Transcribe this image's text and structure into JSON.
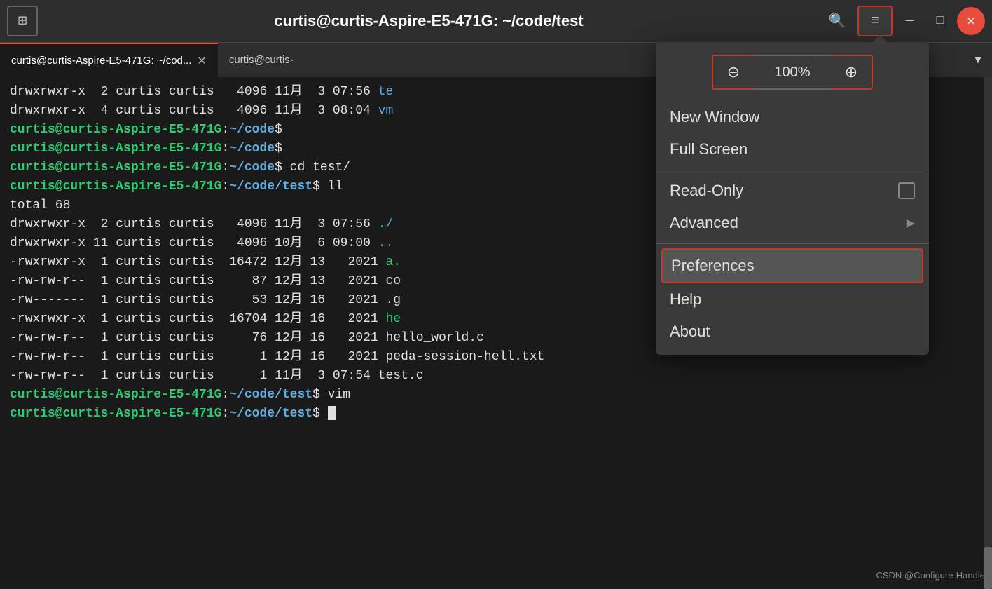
{
  "titlebar": {
    "new_tab_icon": "⊞",
    "title": "curtis@curtis-Aspire-E5-471G: ~/code/test",
    "search_icon": "⌕",
    "menu_icon": "≡",
    "minimize_icon": "—",
    "maximize_icon": "□",
    "close_icon": "✕"
  },
  "tabs": {
    "tab1_label": "curtis@curtis-Aspire-E5-471G: ~/cod...",
    "tab2_label": "curtis@curtis-",
    "dropdown_icon": "▼"
  },
  "terminal": {
    "lines": [
      {
        "type": "file",
        "text": "drwxrwxr-x  2 curtis curtis   4096 11月  3 07:56 ",
        "filename": "te",
        "file_color": "blue"
      },
      {
        "type": "file",
        "text": "drwxrwxr-x  4 curtis curtis   4096 11月  3 08:04 ",
        "filename": "vm",
        "file_color": "blue"
      },
      {
        "type": "prompt",
        "user": "curtis@curtis-Aspire-E5-471G",
        "path": "~/code",
        "cmd": "$"
      },
      {
        "type": "prompt",
        "user": "curtis@curtis-Aspire-E5-471G",
        "path": "~/code",
        "cmd": "$"
      },
      {
        "type": "prompt",
        "user": "curtis@curtis-Aspire-E5-471G",
        "path": "~/code",
        "cmd": "$ cd test/"
      },
      {
        "type": "prompt",
        "user": "curtis@curtis-Aspire-E5-471G",
        "path": "~/code/test",
        "cmd": "$ ll"
      },
      {
        "type": "plain",
        "text": "total 68"
      },
      {
        "type": "file",
        "text": "drwxrwxr-x  2 curtis curtis   4096 11月  3 07:56 ",
        "filename": "./",
        "file_color": "blue"
      },
      {
        "type": "file",
        "text": "drwxrwxr-x 11 curtis curtis   4096 10月  6 09:00 ",
        "filename": "..",
        "file_color": "blue"
      },
      {
        "type": "file",
        "text": "-rwxrwxr-x  1 curtis curtis  16472 12月 13   2021 ",
        "filename": "a.",
        "file_color": "green"
      },
      {
        "type": "file",
        "text": "-rw-rw-r--  1 curtis curtis     87 12月 13   2021 ",
        "filename": "co",
        "file_color": "white"
      },
      {
        "type": "file",
        "text": "-rw-------  1 curtis curtis     53 12月 16   2021 ",
        "filename": ".g",
        "file_color": "white"
      },
      {
        "type": "file",
        "text": "-rwxrwxr-x  1 curtis curtis  16704 12月 16   2021 ",
        "filename": "he",
        "file_color": "green"
      },
      {
        "type": "file",
        "text": "-rw-rw-r--  1 curtis curtis     76 12月 16   2021 ",
        "filename": "hello_world.c",
        "file_color": "white"
      },
      {
        "type": "file",
        "text": "-rw-rw-r--  1 curtis curtis      1 12月 16   2021 ",
        "filename": "peda-session-hell.txt",
        "file_color": "white"
      },
      {
        "type": "file",
        "text": "-rw-rw-r--  1 curtis curtis      1 11月  3 07:54 ",
        "filename": "test.c",
        "file_color": "white"
      },
      {
        "type": "prompt",
        "user": "curtis@curtis-Aspire-E5-471G",
        "path": "~/code/test",
        "cmd": "$ vim"
      },
      {
        "type": "prompt_cursor",
        "user": "curtis@curtis-Aspire-E5-471G",
        "path": "~/code/test",
        "cmd": "$"
      }
    ],
    "watermark": "CSDN @Configure-Handle"
  },
  "menu": {
    "zoom_minus": "⊖",
    "zoom_level": "100%",
    "zoom_plus": "⊕",
    "new_window": "New Window",
    "full_screen": "Full Screen",
    "read_only": "Read-Only",
    "advanced": "Advanced",
    "preferences": "Preferences",
    "help": "Help",
    "about": "About"
  }
}
